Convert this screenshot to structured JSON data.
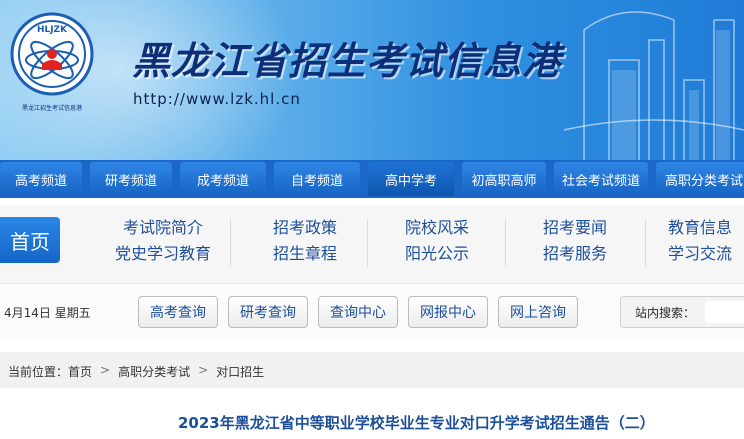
{
  "header": {
    "site_title": "黑龙江省招生考试信息港",
    "url": "http://www.lzk.hl.cn",
    "logo_text": "HLJZK",
    "logo_caption": "黑龙江招生考试信息港",
    "colors": {
      "title": "#0d2f7a",
      "nav": "#1a67c6",
      "link": "#1d4f9c"
    }
  },
  "nav": {
    "items": [
      {
        "label": "高考频道"
      },
      {
        "label": "研考频道"
      },
      {
        "label": "成考频道"
      },
      {
        "label": "自考频道"
      },
      {
        "label": "高中学考"
      },
      {
        "label": "初高职高师"
      },
      {
        "label": "社会考试频道"
      },
      {
        "label": "高职分类考试"
      }
    ]
  },
  "subnav": {
    "home_label": "首页",
    "categories": [
      {
        "top": "考试院简介",
        "bottom": "党史学习教育"
      },
      {
        "top": "招考政策",
        "bottom": "招生章程"
      },
      {
        "top": "院校风采",
        "bottom": "阳光公示"
      },
      {
        "top": "招考要闻",
        "bottom": "招考服务"
      },
      {
        "top": "教育信息",
        "bottom": "学习交流"
      }
    ]
  },
  "toolbar": {
    "date": "4月14日   星期五",
    "buttons": [
      "高考查询",
      "研考查询",
      "查询中心",
      "网报中心",
      "网上咨询"
    ],
    "search_label": "站内搜索：",
    "search_placeholder": ""
  },
  "breadcrumb": {
    "prefix": "当前位置：",
    "items": [
      "首页",
      "高职分类考试",
      "对口招生"
    ]
  },
  "article": {
    "title": "2023年黑龙江省中等职业学校毕业生专业对口升学考试招生通告（二）"
  }
}
